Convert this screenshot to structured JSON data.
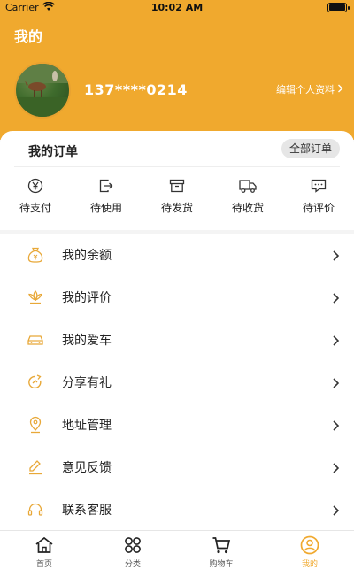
{
  "status_bar": {
    "carrier": "Carrier",
    "time": "10:02 AM"
  },
  "header": {
    "title": "我的",
    "phone": "137****0214",
    "edit_profile": "编辑个人资料",
    "background_color": "#f0a92e"
  },
  "orders": {
    "title": "我的订单",
    "all_orders": "全部订单",
    "items": [
      {
        "label": "待支付",
        "icon": "yen-circle-icon"
      },
      {
        "label": "待使用",
        "icon": "exit-box-icon"
      },
      {
        "label": "待发货",
        "icon": "package-box-icon"
      },
      {
        "label": "待收货",
        "icon": "truck-icon"
      },
      {
        "label": "待评价",
        "icon": "chat-bubble-icon"
      }
    ]
  },
  "menu": {
    "items": [
      {
        "label": "我的余额",
        "icon": "money-bag-icon"
      },
      {
        "label": "我的评价",
        "icon": "lotus-icon"
      },
      {
        "label": "我的爱车",
        "icon": "car-icon"
      },
      {
        "label": "分享有礼",
        "icon": "share-arrow-icon"
      },
      {
        "label": "地址管理",
        "icon": "location-pin-icon"
      },
      {
        "label": "意见反馈",
        "icon": "edit-pencil-icon"
      },
      {
        "label": "联系客服",
        "icon": "headset-icon"
      }
    ],
    "accent_color": "#e8a838"
  },
  "tabbar": {
    "items": [
      {
        "label": "首页",
        "icon": "home-icon",
        "active": false
      },
      {
        "label": "分类",
        "icon": "category-icon",
        "active": false
      },
      {
        "label": "购物车",
        "icon": "cart-icon",
        "active": false
      },
      {
        "label": "我的",
        "icon": "user-icon",
        "active": true
      }
    ],
    "active_color": "#f0a92e"
  }
}
